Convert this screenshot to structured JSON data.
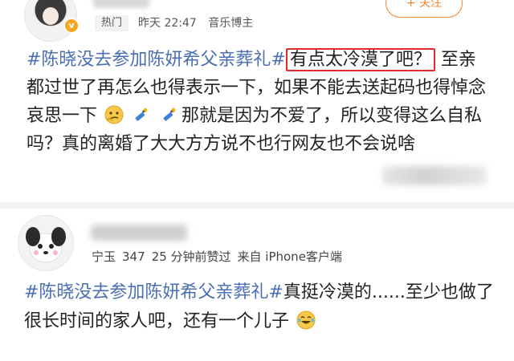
{
  "post": {
    "hot_tag": "热门",
    "time": "昨天 22:47",
    "author_title": "音乐博主",
    "follow_label": "+ 关注",
    "hashtag": "#陈晓没去参加陈妍希父亲葬礼#",
    "highlighted_text": "有点太冷漠了吧？",
    "text_part1": "至亲都过世了再怎么也得表示一下，如果不能去送起码也得悼念哀思一下",
    "text_part2": "那就是因为不爱了，所以变得这么自私吗？真的离婚了大大方方说不也行网友也不会说啥",
    "emojis": [
      "thinking-emoji",
      "candle-emoji",
      "candle-emoji"
    ]
  },
  "comment": {
    "meta_ip": "宁玉",
    "meta_likes": "347",
    "meta_time": "25 分钟前赞过",
    "meta_source": "来自 iPhone客户端",
    "hashtag": "#陈晓没去参加陈妍希父亲葬礼#",
    "text": "真挺冷漠的......至少也做了很长时间的家人吧，还有一个儿子",
    "emoji": "laugh-cry-emoji"
  },
  "colors": {
    "hashtag": "#4a70b3",
    "follow": "#f0862f",
    "highlight_border": "#e32a2a",
    "vip_badge": "#f6a623"
  }
}
